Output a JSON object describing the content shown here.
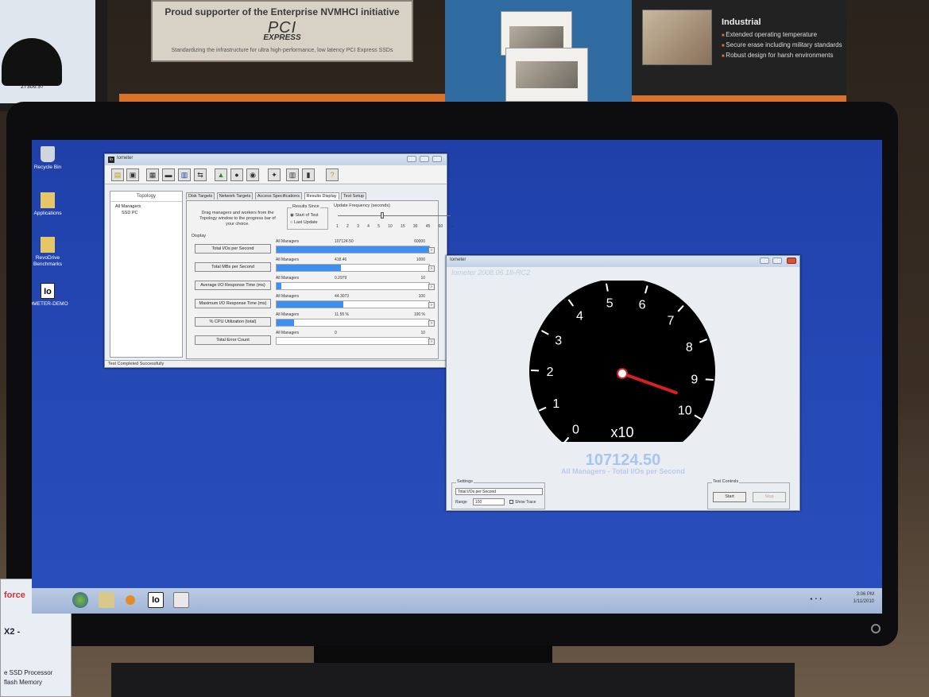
{
  "booth": {
    "banner_line1": "Proud supporter of the Enterprise NVMHCI initiative",
    "banner_line2": "PCI",
    "banner_line3": "EXPRESS",
    "banner_line4": "Standardizing the infrastructure for ultra high-performance, low latency PCI Express SSDs",
    "industrial_title": "Industrial",
    "industrial_items": [
      "Extended operating temperature",
      "Secure erase including military standards",
      "Robust design for harsh environments"
    ],
    "bottom_card": {
      "t1": "force",
      "t2": "X2 -",
      "t3": "e SSD Processor\nflash Memory"
    }
  },
  "small_monitor": {
    "readout": "27306.97"
  },
  "desktop": {
    "icons": [
      {
        "label": "Recycle Bin",
        "icon": "recycle-bin-icon"
      },
      {
        "label": "Applications",
        "icon": "folder-icon"
      },
      {
        "label": "RevoDrive Benchmarks",
        "icon": "folder-icon"
      },
      {
        "label": "IOMETER-DEMO",
        "icon": "iometer-icon"
      }
    ]
  },
  "iometer_main": {
    "title": "Iometer",
    "icon_text": "Io",
    "toolbar_help": "?",
    "topology_header": "Topology",
    "tree": [
      "All Managers",
      "SSD PC"
    ],
    "tabs": [
      "Disk Targets",
      "Network Targets",
      "Access Specifications",
      "Results Display",
      "Test Setup"
    ],
    "active_tab": "Results Display",
    "drag_note": "Drag managers and workers from the Topology window to the progress bar of your choice.",
    "results_since": {
      "caption": "Results Since",
      "opt1": "Start of Test",
      "opt2": "Last Update"
    },
    "update_freq": {
      "caption": "Update Frequency (seconds)",
      "ticks": [
        "1",
        "2",
        "3",
        "4",
        "5",
        "10",
        "15",
        "30",
        "45",
        "60",
        "∞"
      ]
    },
    "display_caption": "Display",
    "rows": [
      {
        "button": "Total I/Os per Second",
        "manager": "All Managers",
        "value": "107124.50",
        "max": "60000",
        "fill": 1.0
      },
      {
        "button": "Total MBs per Second",
        "manager": "All Managers",
        "value": "418.46",
        "max": "1000",
        "fill": 0.42
      },
      {
        "button": "Average I/O Response Time (ms)",
        "manager": "All Managers",
        "value": "0.2979",
        "max": "10",
        "fill": 0.03
      },
      {
        "button": "Maximum I/O Response Time (ms)",
        "manager": "All Managers",
        "value": "44.3073",
        "max": "100",
        "fill": 0.44
      },
      {
        "button": "% CPU Utilization (total)",
        "manager": "All Managers",
        "value": "11.55 %",
        "max": "100 %",
        "fill": 0.115
      },
      {
        "button": "Total Error Count",
        "manager": "All Managers",
        "value": "0",
        "max": "10",
        "fill": 0
      }
    ],
    "status": "Test Completed Successfully"
  },
  "iometer_gauge": {
    "title": "Iometer",
    "subtitle": "Iometer 2008.06.18-RC2",
    "dial_numbers": [
      "0",
      "1",
      "2",
      "3",
      "4",
      "5",
      "6",
      "7",
      "8",
      "9",
      "10"
    ],
    "multiplier": "x10",
    "needle_value": 9.6,
    "value": "107124.50",
    "caption": "All Managers - Total I/Os per Second",
    "settings": {
      "caption": "Settings",
      "selected": "Total I/Os per Second",
      "range_label": "Range",
      "range_value": "100",
      "trace_label": "Show Trace"
    },
    "controls": {
      "caption": "Test Controls",
      "start": "Start",
      "stop": "Stop"
    }
  },
  "taskbar": {
    "pinned_text": "Io",
    "clock_time": "3:06 PM",
    "clock_date": "1/11/2010"
  }
}
